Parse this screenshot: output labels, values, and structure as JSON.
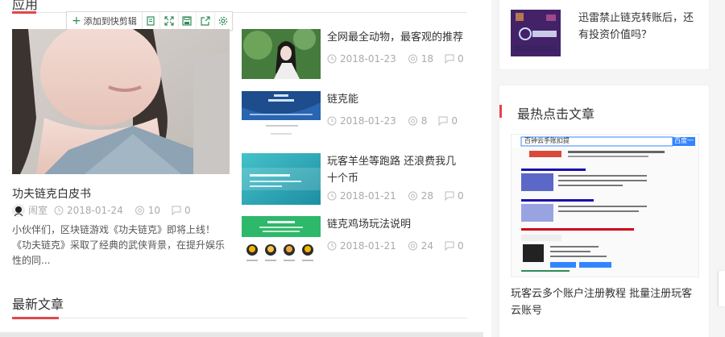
{
  "left": {
    "section1_title": "应用",
    "toolbar": {
      "clip_label": "添加到快剪辑",
      "icons": [
        "doc-icon",
        "expand-icon",
        "save-icon",
        "share-icon",
        "settings-icon"
      ]
    },
    "feature": {
      "title": "功夫链克白皮书",
      "author": "闹室",
      "date": "2018-01-24",
      "views": "10",
      "comments": "0",
      "excerpt": "小伙伴们，区块链游戏《功夫链克》即将上线！《功夫链克》采取了经典的武侠背景，在提升娱乐性的同..."
    },
    "posts": [
      {
        "title": "全网最全动物，最客观的推荐",
        "date": "2018-01-23",
        "views": "18",
        "comments": "0"
      },
      {
        "title": "链克能",
        "date": "2018-01-23",
        "views": "8",
        "comments": "0"
      },
      {
        "title": "玩客羊坐等跑路 还浪费我几十个币",
        "date": "2018-01-21",
        "views": "28",
        "comments": "0"
      },
      {
        "title": "链克鸡场玩法说明",
        "date": "2018-01-21",
        "views": "24",
        "comments": "0"
      }
    ],
    "section2_title": "最新文章"
  },
  "right": {
    "top_card_title": "迅雷禁止链克转账后，还有投资价值吗？",
    "hot_title": "最热点击文章",
    "hot_article_title": "玩客云多个账户注册教程 批量注册玩客云账号",
    "hot_img_search": "百钟云手账扣提",
    "hot_img_button": "百度一"
  },
  "colors": {
    "accent": "#e0474c",
    "meta": "#aaaaaa",
    "text": "#333333"
  }
}
